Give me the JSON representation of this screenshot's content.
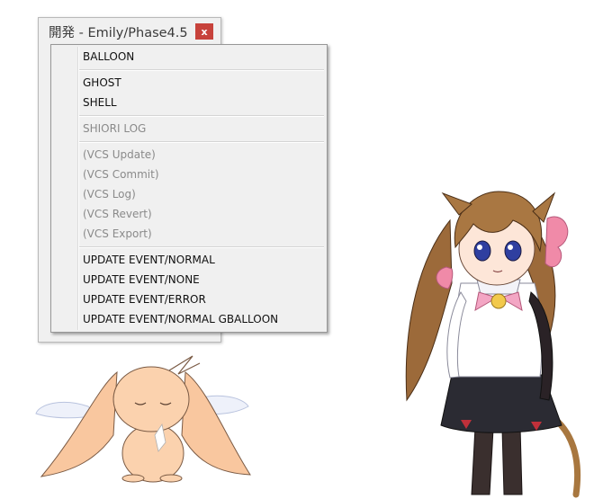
{
  "window": {
    "title": "開発 - Emily/Phase4.5",
    "close_label": "x",
    "close_color": "#c7423b"
  },
  "menu": {
    "groups": [
      {
        "items": [
          {
            "label": "BALLOON",
            "enabled": true
          }
        ]
      },
      {
        "items": [
          {
            "label": "GHOST",
            "enabled": true
          },
          {
            "label": "SHELL",
            "enabled": true
          }
        ]
      },
      {
        "items": [
          {
            "label": "SHIORI LOG",
            "enabled": false
          }
        ]
      },
      {
        "items": [
          {
            "label": "(VCS Update)",
            "enabled": false
          },
          {
            "label": "(VCS Commit)",
            "enabled": false
          },
          {
            "label": "(VCS Log)",
            "enabled": false
          },
          {
            "label": "(VCS Revert)",
            "enabled": false
          },
          {
            "label": "(VCS Export)",
            "enabled": false
          }
        ]
      },
      {
        "items": [
          {
            "label": "UPDATE EVENT/NORMAL",
            "enabled": true
          },
          {
            "label": "UPDATE EVENT/NONE",
            "enabled": true
          },
          {
            "label": "UPDATE EVENT/ERROR",
            "enabled": true
          },
          {
            "label": "UPDATE EVENT/NORMAL GBALLOON",
            "enabled": true
          }
        ]
      }
    ]
  },
  "characters": [
    {
      "icon": "winged-creature-mascot"
    },
    {
      "icon": "cat-eared-girl-character"
    }
  ]
}
